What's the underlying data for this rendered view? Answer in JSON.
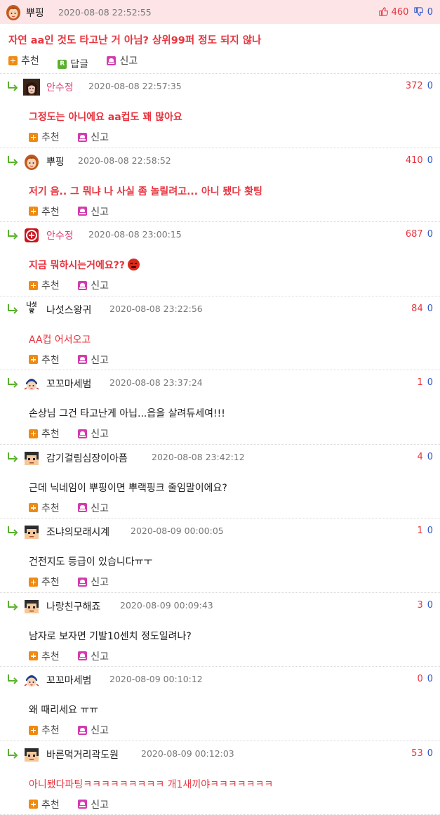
{
  "top": {
    "nick": "뿌핑",
    "date": "2020-08-08 22:52:55",
    "up": "460",
    "down": "0",
    "body": "자연 aa인 것도 타고난 거 아님? 상위99퍼 정도 되지 않나",
    "recommend": "추천",
    "reply": "답글",
    "report": "신고",
    "reply_icon_letter": "R"
  },
  "replies": [
    {
      "nick": "안수정",
      "date": "2020-08-08 22:57:35",
      "up": "372",
      "down": "0",
      "body": "그정도는 아니에요 aa컵도 꽤 많아요",
      "recommend": "추천",
      "report": "신고",
      "avatar": "girl-photo"
    },
    {
      "nick": "뿌핑",
      "date": "2020-08-08 22:58:52",
      "up": "410",
      "down": "0",
      "body": "저기 음.. 그 뭐냐 나 사실 좀 놀릴려고... 아니 됐다 홧팅",
      "recommend": "추천",
      "report": "신고",
      "avatar": "girl-cartoon"
    },
    {
      "nick": "안수정",
      "date": "2020-08-08 23:00:15",
      "up": "687",
      "down": "0",
      "body": "지금 뭐하시는거에요??",
      "recommend": "추천",
      "report": "신고",
      "avatar": "red-seal"
    },
    {
      "nick": "나섯스왕귀",
      "date": "2020-08-08 23:22:56",
      "up": "84",
      "down": "0",
      "body": "AA컵 어서오고",
      "recommend": "추천",
      "report": "신고",
      "avatar_text": "나섯\n왕"
    },
    {
      "nick": "꼬꼬마세범",
      "date": "2020-08-08 23:37:24",
      "up": "1",
      "down": "0",
      "body": "손상님 그건 타고난게 아닙...읍을 살려듀세여!!!",
      "recommend": "추천",
      "report": "신고",
      "avatar": "boy-cartoon"
    },
    {
      "nick": "감기걸림심장이아픔",
      "date": "2020-08-08 23:42:12",
      "up": "4",
      "down": "0",
      "body": "근데 닉네임이 뿌핑이면 뿌랙핑크 줄임말이에요?",
      "recommend": "추천",
      "report": "신고",
      "avatar": "pixel-man"
    },
    {
      "nick": "조냐의모래시계",
      "date": "2020-08-09 00:00:05",
      "up": "1",
      "down": "0",
      "body": "건전지도 등급이 있습니다ㅠㅜ",
      "recommend": "추천",
      "report": "신고",
      "avatar": "pixel-man"
    },
    {
      "nick": "나랑친구해죠",
      "date": "2020-08-09 00:09:43",
      "up": "3",
      "down": "0",
      "body": "남자로 보자면 기발10센치 정도일려나?",
      "recommend": "추천",
      "report": "신고",
      "avatar": "pixel-man"
    },
    {
      "nick": "꼬꼬마세범",
      "date": "2020-08-09 00:10:12",
      "up": "0",
      "down": "0",
      "body": "왜 때리세요 ㅠㅠ",
      "recommend": "추천",
      "report": "신고",
      "avatar": "boy-cartoon"
    },
    {
      "nick": "바른먹거리곽도원",
      "date": "2020-08-09 00:12:03",
      "up": "53",
      "down": "0",
      "body": "아니됐다파팅ㅋㅋㅋㅋㅋㅋㅋㅋㅋ 개1새끼야ㅋㅋㅋㅋㅋㅋㅋ",
      "recommend": "추천",
      "report": "신고",
      "avatar": "pixel-man"
    }
  ],
  "colors": {
    "accent_red": "#e8333e",
    "down_blue": "#2b55c9",
    "top_bg": "#fde4e7",
    "pink_nick": "#e0407a"
  }
}
